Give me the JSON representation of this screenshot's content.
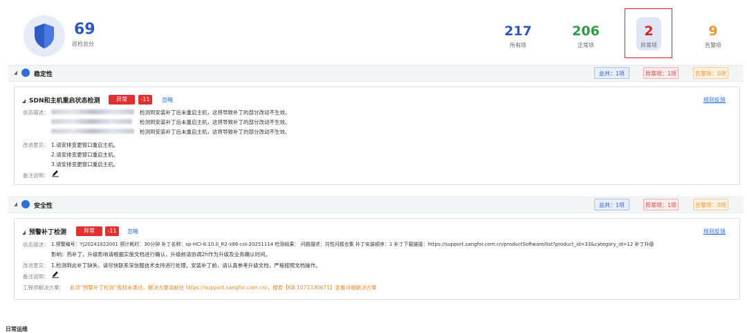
{
  "summary": {
    "score": "69",
    "score_label": "巡检总分",
    "stats": [
      {
        "value": "217",
        "label": "所有项",
        "color": "#2f55c5"
      },
      {
        "value": "206",
        "label": "正常项",
        "color": "#2e9b4a"
      },
      {
        "value": "2",
        "label": "异常项",
        "color": "#e02020"
      },
      {
        "value": "9",
        "label": "告警项",
        "color": "#f0952a"
      }
    ]
  },
  "sections": [
    {
      "title": "稳定性",
      "total": "总共：1项",
      "abnormal": "异常项：1项",
      "warning": "告警项：0项",
      "card": {
        "title": "SDN和主机重启状态检测",
        "status_tag": "异常",
        "score_tag": "-11",
        "ignore": "忽略",
        "feedback": "规则反馈",
        "desc_label": "状态描述：",
        "desc_lines": [
          "检测到安装补丁后未重启主机，这将导致补丁的部分改动不生效。",
          "检测到安装补丁后未重启主机，这将导致补丁的部分改动不生效。",
          "检测到安装补丁后未重启主机，这将导致补丁的部分改动不生效。"
        ],
        "advice_label": "改进意见：",
        "advice_lines": [
          "1.请安排变更窗口重启主机。",
          "2.请安排变更窗口重启主机。",
          "3.请安排变更窗口重启主机。"
        ],
        "note_label": "备注说明："
      }
    },
    {
      "title": "安全性",
      "total": "总共：1项",
      "abnormal": "异常项：1项",
      "warning": "告警项：0项",
      "card": {
        "title": "预警补丁检测",
        "status_tag": "异常",
        "score_tag": "-11",
        "ignore": "忽略",
        "feedback": "规则反馈",
        "desc_label": "状态描述：",
        "desc_line1": "1.预警编号：YJ20241022001 预计耗时：30分钟 补丁名称：sp-HCI-6.10.0_R2-x86-col-20251114 检测结果： 问题描述：共性问题合集 补丁安装顺序：1 补丁下载链接：https://support.sangfor.com.cn/productSoftware/list?product_id=33&category_id=12 补丁升级",
        "desc_line2": "影响：热补丁，升级影响请根据实施文档进行确认，升级前请协调2h作为升级及业务确认时间。",
        "advice_label": "改进意见：",
        "advice_line": "1.检测到此补丁缺失，请尽快联系深信服技术支持进行处理。安装补丁前，请认真参考升级文档，严格按照文档操作。",
        "note_label": "备注说明：",
        "solution_label": "工程师解决方案：",
        "solution_text": "此项“预警补丁检测”规则未通过，解决方案请前往 https://support.sangfor.com.cn/，搜索【KB:1071330671】查看详细解决方案"
      }
    }
  ],
  "bottom_title": "日常运维"
}
